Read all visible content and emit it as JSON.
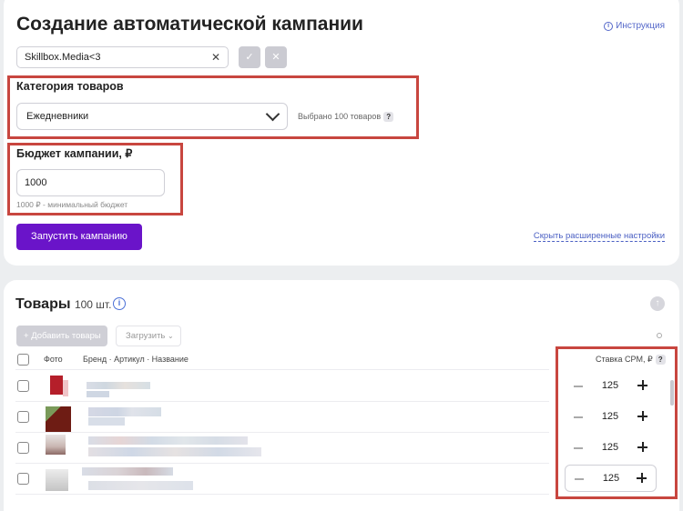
{
  "header": {
    "title": "Создание автоматической кампании",
    "help_link": "Инструкция"
  },
  "campaign_name": {
    "value": "Skillbox.Media<3",
    "confirm_icon": "✓",
    "cancel_icon": "✕"
  },
  "category": {
    "label": "Категория товаров",
    "selected": "Ежедневники",
    "selected_count": "Выбрано 100 товаров",
    "help_badge": "?"
  },
  "budget": {
    "label": "Бюджет кампании, ₽",
    "value": "1000",
    "hint": "1000 ₽ - минимальный бюджет"
  },
  "actions": {
    "run_button": "Запустить кампанию",
    "hide_advanced": "Скрыть расширенные настройки"
  },
  "products": {
    "title": "Товары",
    "count": "100 шт.",
    "add_button": "Добавить товары",
    "upload_button": "Загрузить",
    "columns": {
      "photo": "Фото",
      "brand_article_name": "Бренд · Артикул · Название",
      "cpm": "Ставка CPM, ₽",
      "cpm_help": "?"
    },
    "rows": [
      {
        "cpm": "125"
      },
      {
        "cpm": "125"
      },
      {
        "cpm": "125"
      },
      {
        "cpm": "125"
      }
    ]
  },
  "colors": {
    "accent": "#6a14c9",
    "link": "#4a5fc3",
    "highlight": "#c8463f"
  }
}
